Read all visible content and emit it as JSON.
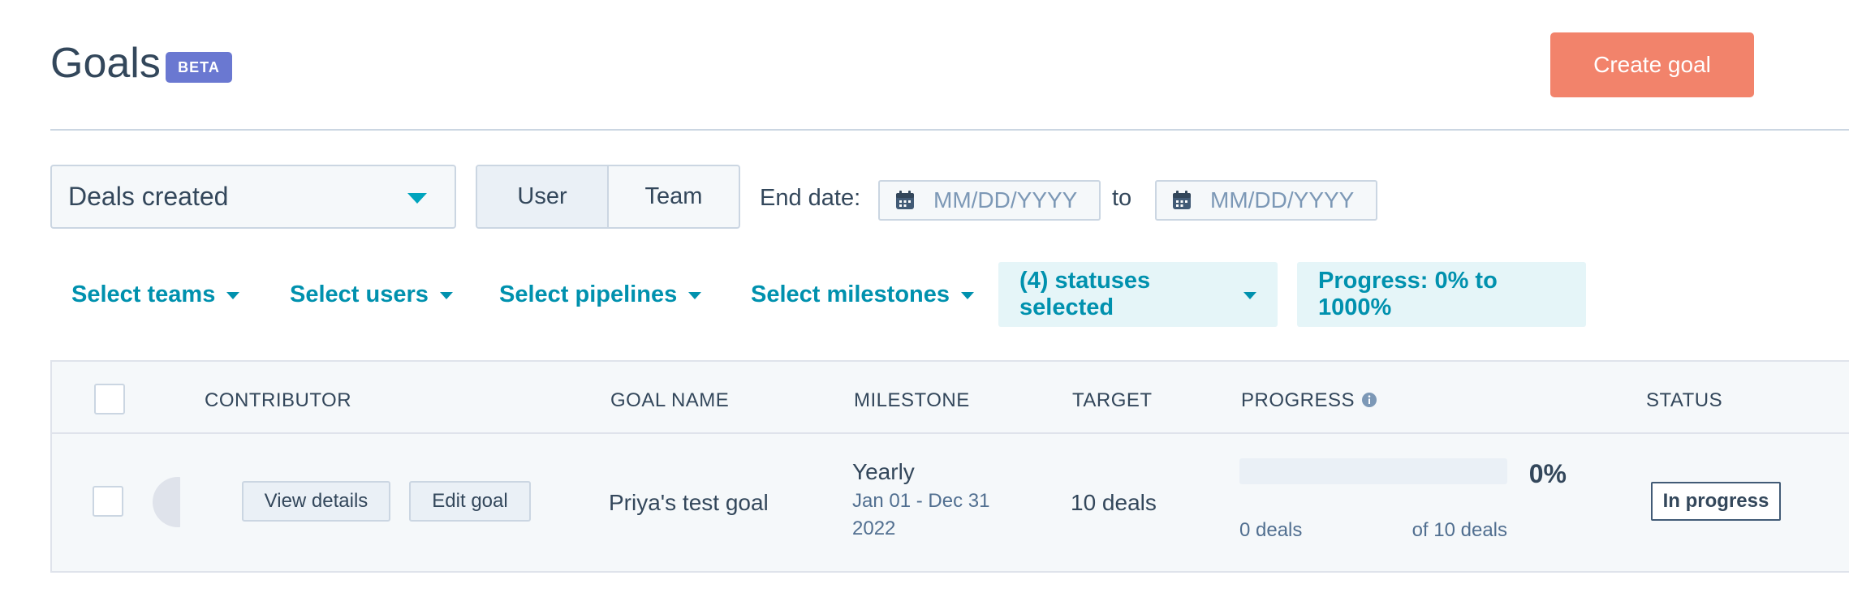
{
  "header": {
    "title": "Goals",
    "badge": "BETA",
    "create_label": "Create goal"
  },
  "filters": {
    "metric_select": "Deals created",
    "toggle": {
      "options": [
        "User",
        "Team"
      ],
      "selected": "User"
    },
    "end_date_label": "End date:",
    "start_placeholder": "MM/DD/YYYY",
    "to_label": "to",
    "end_placeholder": "MM/DD/YYYY",
    "teams": "Select teams",
    "users": "Select users",
    "pipelines": "Select pipelines",
    "milestones": "Select milestones",
    "statuses": "(4) statuses selected",
    "progress": "Progress: 0% to 1000%"
  },
  "table": {
    "columns": [
      "CONTRIBUTOR",
      "GOAL NAME",
      "MILESTONE",
      "TARGET",
      "PROGRESS",
      "STATUS"
    ],
    "rows": [
      {
        "view_details": "View details",
        "edit_goal": "Edit goal",
        "goal_name": "Priya's test goal",
        "milestone": "Yearly",
        "milestone_range": "Jan 01 - Dec 31",
        "milestone_year": "2022",
        "target": "10 deals",
        "progress_percent": "0%",
        "progress_fraction": 0,
        "progress_current": "0 deals",
        "progress_total": "of 10 deals",
        "status": "In progress"
      }
    ]
  },
  "colors": {
    "accent_orange": "#f2836b",
    "beta_badge": "#6a78d1",
    "link_teal": "#0091ae",
    "text": "#33475b"
  },
  "icons": {
    "metric_dropdown": "chevron-down-icon",
    "date_inputs": "calendar-icon",
    "progress_header": "info-icon"
  }
}
